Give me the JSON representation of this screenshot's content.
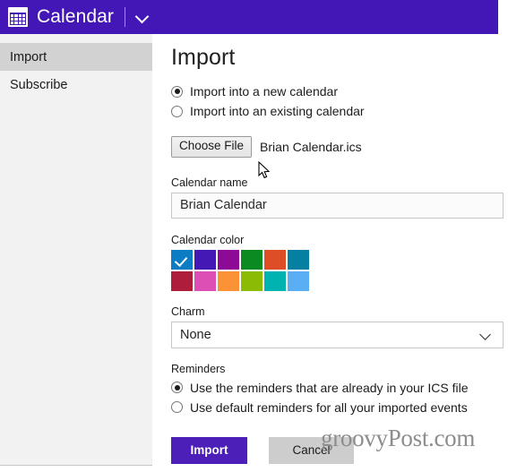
{
  "window": {
    "title": "Calendar",
    "icon": "calendar-grid-icon",
    "chevron": "chevron-down-icon",
    "header_color": "#4317b5"
  },
  "sidebar": {
    "items": [
      {
        "label": "Import",
        "active": true
      },
      {
        "label": "Subscribe",
        "active": false
      }
    ]
  },
  "main": {
    "page_title": "Import",
    "import_mode": {
      "options": [
        {
          "label": "Import into a new calendar",
          "selected": true
        },
        {
          "label": "Import into an existing calendar",
          "selected": false
        }
      ]
    },
    "file": {
      "button_label": "Choose File",
      "file_name": "Brian Calendar.ics"
    },
    "calendar_name": {
      "label": "Calendar name",
      "value": "Brian Calendar",
      "placeholder": ""
    },
    "calendar_color": {
      "label": "Calendar color",
      "selected_index": 0,
      "swatches": [
        {
          "name": "blue",
          "hex": "#0c7cc4"
        },
        {
          "name": "indigo",
          "hex": "#4318b4"
        },
        {
          "name": "purple",
          "hex": "#8c0a96"
        },
        {
          "name": "green",
          "hex": "#0a8a20"
        },
        {
          "name": "orange-red",
          "hex": "#dd4d26"
        },
        {
          "name": "teal",
          "hex": "#0680a0"
        },
        {
          "name": "crimson",
          "hex": "#ae1d3c"
        },
        {
          "name": "pink",
          "hex": "#dd4fb4"
        },
        {
          "name": "orange",
          "hex": "#fc9236"
        },
        {
          "name": "yellow-green",
          "hex": "#8cbb05"
        },
        {
          "name": "cyan",
          "hex": "#00b3b0"
        },
        {
          "name": "light-blue",
          "hex": "#5aaef4"
        }
      ]
    },
    "charm": {
      "label": "Charm",
      "value": "None",
      "options": [
        "None"
      ],
      "chevron": "chevron-down-icon"
    },
    "reminders": {
      "label": "Reminders",
      "options": [
        {
          "label": "Use the reminders that are already in your ICS file",
          "selected": true
        },
        {
          "label": "Use default reminders for all your imported events",
          "selected": false
        }
      ]
    },
    "buttons": {
      "primary": "Import",
      "secondary": "Cancel"
    }
  },
  "watermark": {
    "text": "groovyPost.com"
  }
}
